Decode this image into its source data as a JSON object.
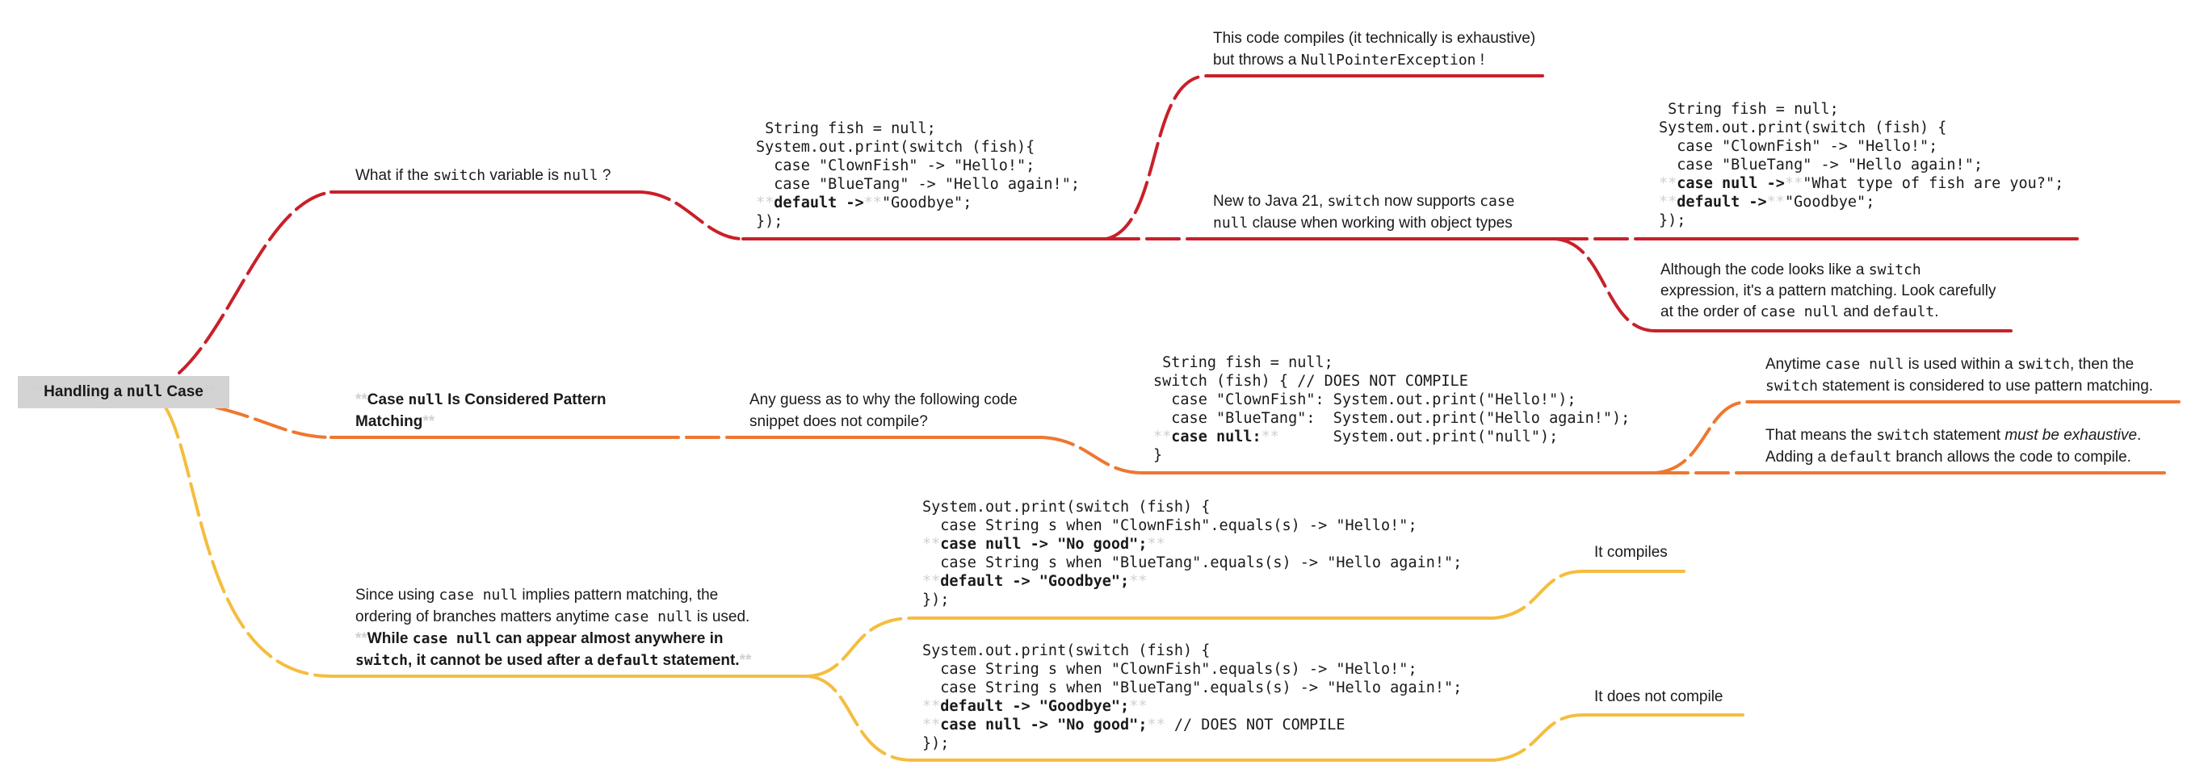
{
  "colors": {
    "red": "#c8202a",
    "orange": "#ee7730",
    "yellow": "#f5bd3f",
    "root_bg": "#d3d3d3"
  },
  "root": {
    "pre": "Handling a ",
    "code": "null",
    "post": " Case"
  },
  "red": {
    "question": {
      "pre": "What if the ",
      "code1": "switch",
      "mid": " variable is ",
      "code2": "null",
      "post": " ?"
    },
    "code1": [
      " String fish = null;",
      "System.out.print(switch (fish){",
      "  case \"ClownFish\" -> \"Hello!\";",
      "  case \"BlueTang\" -> \"Hello again!\";"
    ],
    "code1_default_kw": "default ->",
    "code1_default_val": "\"Goodbye\";",
    "code1_end": "});",
    "compiles_note": {
      "line1": "This code compiles (it technically is exhaustive)",
      "line2_pre": "but throws a ",
      "line2_code": "NullPointerException",
      "line2_post": " !"
    },
    "java21_note": {
      "line1_pre": "New to Java 21, ",
      "line1_code1": "switch",
      "line1_mid": " now supports ",
      "line1_code2": "case",
      "line2_code": "null",
      "line2_post": " clause when working with object types"
    },
    "code2": [
      " String fish = null;",
      "System.out.print(switch (fish) {",
      "  case \"ClownFish\" -> \"Hello!\";",
      "  case \"BlueTang\" -> \"Hello again!\";"
    ],
    "code2_null_kw": "case null ->",
    "code2_null_val": "\"What type of fish are you?\";",
    "code2_default_kw": "default ->",
    "code2_default_val": "\"Goodbye\";",
    "code2_end": "});",
    "pattern_note": {
      "line1_pre": "Although the code looks like a ",
      "line1_code": "switch",
      "line2": "expression, it's a pattern matching. Look carefully",
      "line3_pre": "at the order of ",
      "line3_code1": "case null",
      "line3_mid": " and ",
      "line3_code2": "default",
      "line3_post": "."
    }
  },
  "orange": {
    "title": {
      "pre": "Case ",
      "code": "null",
      "post1": " Is Considered Pattern",
      "post2": "Matching"
    },
    "question": {
      "line1": "Any guess as to why the following code",
      "line2": "snippet does not compile?"
    },
    "code": [
      " String fish = null;",
      "switch (fish) { // DOES NOT COMPILE",
      "  case \"ClownFish\": System.out.print(\"Hello!\");",
      "  case \"BlueTang\":  System.out.print(\"Hello again!\");"
    ],
    "code_null_kw": "case null:",
    "code_null_val": "System.out.print(\"null\");",
    "code_end": "}",
    "anytime_note": {
      "line1_pre": "Anytime ",
      "line1_code1": "case null",
      "line1_mid": " is used within a ",
      "line1_code2": "switch",
      "line1_post": ", then the",
      "line2_code": "switch",
      "line2_post": " statement is considered to use pattern matching."
    },
    "exhaustive_note": {
      "line1_pre": "That means the ",
      "line1_code": "switch",
      "line1_mid": " statement ",
      "line1_italic": "must be exhaustive",
      "line1_post": ".",
      "line2_pre": "Adding a ",
      "line2_code": "default",
      "line2_post": " branch allows the code to compile."
    }
  },
  "yellow": {
    "note": {
      "line1_pre": "Since using ",
      "line1_code": "case null",
      "line1_post": " implies pattern matching, the",
      "line2_pre": "ordering of branches matters anytime ",
      "line2_code": "case null",
      "line2_post": " is used.",
      "line3_pre": "While ",
      "line3_code": "case null",
      "line3_post": " can appear almost anywhere in",
      "line4_code1": "switch",
      "line4_mid": ", it cannot be used after a ",
      "line4_code2": "default",
      "line4_post": " statement."
    },
    "code1_l1": "System.out.print(switch (fish) {",
    "code1_l2": "  case String s when \"ClownFish\".equals(s) -> \"Hello!\";",
    "code1_l3": "case null -> \"No good\";",
    "code1_l4": "  case String s when \"BlueTang\".equals(s) -> \"Hello again!\";",
    "code1_l5": "default -> \"Goodbye\";",
    "code1_l6": "});",
    "result1": "It compiles",
    "code2_l1": "System.out.print(switch (fish) {",
    "code2_l2": "  case String s when \"ClownFish\".equals(s) -> \"Hello!\";",
    "code2_l3": "  case String s when \"BlueTang\".equals(s) -> \"Hello again!\";",
    "code2_l4": "default -> \"Goodbye\";",
    "code2_l5_kw": "case null -> \"No good\";",
    "code2_l5_comment": "// DOES NOT COMPILE",
    "code2_l6": "});",
    "result2": "It does not compile"
  }
}
